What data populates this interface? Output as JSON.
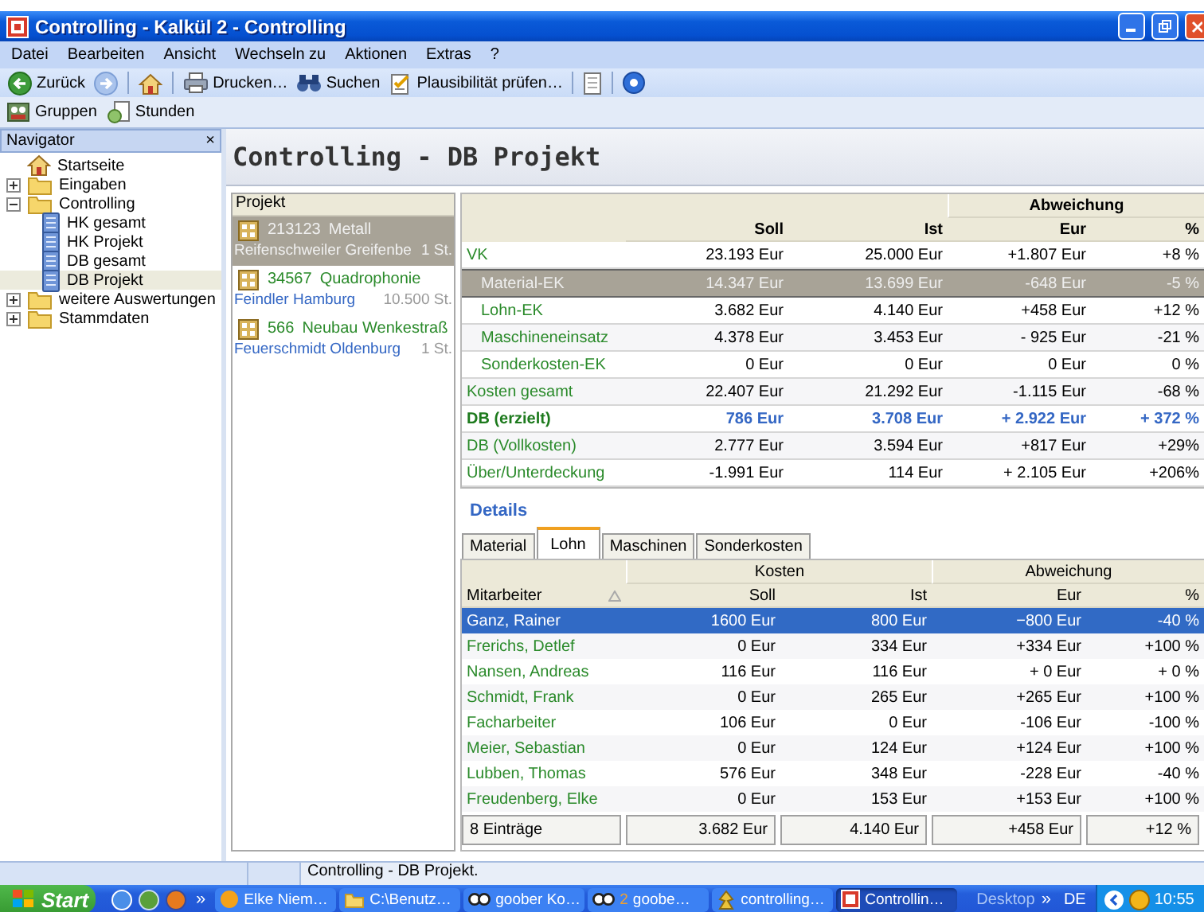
{
  "window": {
    "title": "Controlling - Kalkül 2 - Controlling"
  },
  "menu": [
    "Datei",
    "Bearbeiten",
    "Ansicht",
    "Wechseln zu",
    "Aktionen",
    "Extras",
    "?"
  ],
  "toolbar": [
    {
      "kind": "back",
      "label": "Zurück"
    },
    {
      "kind": "forward"
    },
    {
      "kind": "home"
    },
    {
      "kind": "print",
      "label": "Drucken…"
    },
    {
      "kind": "search",
      "label": "Suchen"
    },
    {
      "kind": "check",
      "label": "Plausibilität prüfen…"
    },
    {
      "kind": "panel"
    },
    {
      "kind": "help"
    }
  ],
  "toolbar2": [
    {
      "kind": "groups",
      "label": "Gruppen"
    },
    {
      "kind": "hours",
      "label": "Stunden"
    }
  ],
  "navigator": {
    "title": "Navigator",
    "close": "×",
    "items": [
      {
        "kind": "home",
        "label": "Startseite",
        "selected": false
      },
      {
        "kind": "folder",
        "label": "Eingaben",
        "expanded": false,
        "selected": false
      },
      {
        "kind": "folder",
        "label": "Controlling",
        "expanded": true,
        "selected": false,
        "children": [
          {
            "kind": "report",
            "label": "HK gesamt",
            "selected": false
          },
          {
            "kind": "report",
            "label": "HK Projekt",
            "selected": false
          },
          {
            "kind": "report",
            "label": "DB gesamt",
            "selected": false
          },
          {
            "kind": "report",
            "label": "DB Projekt",
            "selected": true
          }
        ]
      },
      {
        "kind": "folder",
        "label": "weitere Auswertungen",
        "expanded": false,
        "selected": false
      },
      {
        "kind": "folder",
        "label": "Stammdaten",
        "expanded": false,
        "selected": false
      }
    ]
  },
  "page_title": "Controlling - DB Projekt",
  "projects": {
    "title": "Projekt",
    "items": [
      {
        "number": "213123",
        "name": "Metall",
        "customer": "Reifenschweiler Greifenbe",
        "quantity": "1 St.",
        "selected": true
      },
      {
        "number": "34567",
        "name": "Quadrophonie",
        "customer": "Feindler Hamburg",
        "quantity": "10.500 St.",
        "selected": false
      },
      {
        "number": "566",
        "name": "Neubau Wenkestraß",
        "customer": "Feuerschmidt Oldenburg",
        "quantity": "1 St.",
        "selected": false
      }
    ]
  },
  "db_table": {
    "group_header": "Abweichung",
    "columns": [
      "Soll",
      "Ist",
      "Eur",
      "%"
    ],
    "rows": [
      {
        "kind": "main",
        "label": "VK",
        "values": [
          "23.193 Eur",
          "25.000 Eur",
          "+1.807 Eur",
          "+8 %"
        ],
        "selected": false
      },
      {
        "kind": "sub",
        "label": "Material-EK",
        "values": [
          "14.347 Eur",
          "13.699 Eur",
          "-648 Eur",
          "-5 %"
        ],
        "selected": true
      },
      {
        "kind": "sub",
        "label": "Lohn-EK",
        "values": [
          "3.682 Eur",
          "4.140 Eur",
          "+458 Eur",
          "+12 %"
        ],
        "selected": false
      },
      {
        "kind": "sub",
        "label": "Maschineneinsatz",
        "values": [
          "4.378 Eur",
          "3.453 Eur",
          "- 925 Eur",
          "-21 %"
        ],
        "selected": false
      },
      {
        "kind": "sub",
        "label": "Sonderkosten-EK",
        "values": [
          "0 Eur",
          "0 Eur",
          "0 Eur",
          "0 %"
        ],
        "selected": false
      },
      {
        "kind": "main",
        "label": "Kosten gesamt",
        "values": [
          "22.407 Eur",
          "21.292 Eur",
          "-1.115 Eur",
          "-68 %"
        ],
        "selected": false
      },
      {
        "kind": "total",
        "label": "DB (erzielt)",
        "values": [
          "786 Eur",
          "3.708 Eur",
          "+ 2.922 Eur",
          "+ 372 %"
        ],
        "selected": false
      },
      {
        "kind": "main",
        "label": "DB (Vollkosten)",
        "values": [
          "2.777 Eur",
          "3.594 Eur",
          "+817 Eur",
          "+29%"
        ],
        "selected": false
      },
      {
        "kind": "main",
        "label": "Über/Unterdeckung",
        "values": [
          "-1.991 Eur",
          "114 Eur",
          "+ 2.105 Eur",
          "+206%"
        ],
        "selected": false
      }
    ]
  },
  "details": {
    "title": "Details",
    "tabs": [
      {
        "label": "Material",
        "selected": false
      },
      {
        "label": "Lohn",
        "selected": true
      },
      {
        "label": "Maschinen",
        "selected": false
      },
      {
        "label": "Sonderkosten",
        "selected": false
      }
    ],
    "group_headers": [
      "Kosten",
      "Abweichung"
    ],
    "columns": [
      "Mitarbeiter",
      "Soll",
      "Ist",
      "Eur",
      "%"
    ],
    "rows": [
      {
        "cells": [
          "Ganz, Rainer",
          "1600 Eur",
          "800 Eur",
          "−800 Eur",
          "-40 %"
        ],
        "selected": true
      },
      {
        "cells": [
          "Frerichs, Detlef",
          "0 Eur",
          "334 Eur",
          "+334 Eur",
          "+100 %"
        ],
        "selected": false
      },
      {
        "cells": [
          "Nansen, Andreas",
          "116 Eur",
          "116 Eur",
          "+ 0 Eur",
          "+ 0 %"
        ],
        "selected": false
      },
      {
        "cells": [
          "Schmidt, Frank",
          "0 Eur",
          "265 Eur",
          "+265 Eur",
          "+100 %"
        ],
        "selected": false
      },
      {
        "cells": [
          "Facharbeiter",
          "106 Eur",
          "0 Eur",
          "-106 Eur",
          "-100 %"
        ],
        "selected": false
      },
      {
        "cells": [
          "Meier, Sebastian",
          "0 Eur",
          "124 Eur",
          "+124 Eur",
          "+100 %"
        ],
        "selected": false
      },
      {
        "cells": [
          "Lubben, Thomas",
          "576 Eur",
          "348 Eur",
          "-228 Eur",
          "-40 %"
        ],
        "selected": false
      },
      {
        "cells": [
          "Freudenberg, Elke",
          "0 Eur",
          "153 Eur",
          "+153 Eur",
          "+100 %"
        ],
        "selected": false
      }
    ],
    "footer": [
      "8 Einträge",
      "3.682 Eur",
      "4.140 Eur",
      "+458 Eur",
      "+12 %"
    ]
  },
  "status_bar": {
    "text": "Controlling - DB Projekt."
  },
  "taskbar": {
    "start": "Start",
    "chevron": "»",
    "tasks": [
      {
        "kind": "browser",
        "label": "Elke Niem…",
        "selected": false
      },
      {
        "kind": "folder",
        "label": "C:\\Benutz…",
        "selected": false
      },
      {
        "kind": "chat",
        "label": "goober Ko…",
        "selected": false
      },
      {
        "kind": "chat",
        "count": "2",
        "label": "goobe…",
        "selected": false
      },
      {
        "kind": "tool",
        "label": "controlling…",
        "selected": false
      },
      {
        "kind": "app",
        "label": "Controllin…",
        "selected": true
      }
    ],
    "desktop": "Desktop",
    "desktop_chevron": "»",
    "language": "DE",
    "time": "10:55"
  }
}
